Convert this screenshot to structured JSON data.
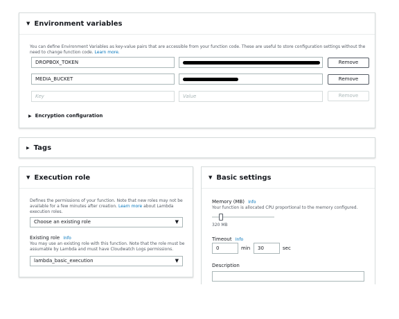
{
  "env_vars": {
    "title": "Environment variables",
    "description": "You can define Environment Variables as key-value pairs that are accessible from your function code. These are useful to store configuration settings without the need to change function code.",
    "learn_more": "Learn more.",
    "rows": [
      {
        "key": "DROPBOX_TOKEN",
        "value": "",
        "remove": "Remove"
      },
      {
        "key": "MEDIA_BUCKET",
        "value": "",
        "remove": "Remove"
      }
    ],
    "new_row": {
      "key_placeholder": "Key",
      "value_placeholder": "Value",
      "remove": "Remove"
    },
    "encryption": "Encryption configuration"
  },
  "tags": {
    "title": "Tags"
  },
  "execution_role": {
    "title": "Execution role",
    "description": "Defines the permissions of your function. Note that new roles may not be available for a few minutes after creation.",
    "learn_more": "Learn more",
    "description_tail": "about Lambda execution roles.",
    "role_select": "Choose an existing role",
    "existing_label": "Existing role",
    "existing_info": "Info",
    "existing_desc": "You may use an existing role with this function. Note that the role must be assumable by Lambda and must have Cloudwatch Logs permissions.",
    "existing_select": "lambda_basic_execution"
  },
  "basic_settings": {
    "title": "Basic settings",
    "memory_label": "Memory (MB)",
    "memory_info": "Info",
    "memory_desc": "Your function is allocated CPU proportional to the memory configured.",
    "memory_value": "320 MB",
    "memory_fraction": 0.05,
    "timeout_label": "Timeout",
    "timeout_info": "Info",
    "timeout_min": "0",
    "min_label": "min",
    "timeout_sec": "30",
    "sec_label": "sec",
    "description_label": "Description",
    "description_value": ""
  },
  "colors": {
    "link": "#0073bb",
    "border": "#d5dbdb",
    "text": "#16191f"
  }
}
